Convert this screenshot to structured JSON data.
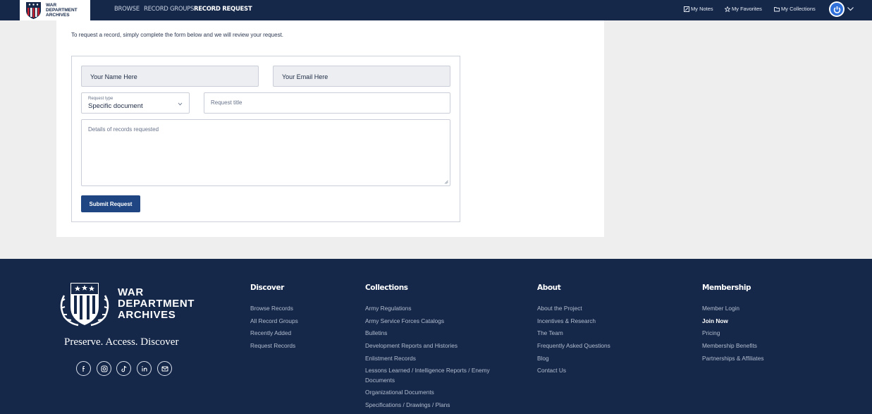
{
  "brand": {
    "logo_lines": [
      "WAR",
      "DEPARTMENT",
      "ARCHIVES"
    ],
    "footer_brand_lines": [
      "WAR",
      "DEPARTMENT",
      "ARCHIVES"
    ],
    "tagline": "Preserve. Access. Discover"
  },
  "nav": {
    "links": [
      "BROWSE",
      "RECORD GROUPS",
      "RECORD REQUEST"
    ],
    "active": "RECORD REQUEST",
    "utility": [
      "My Notes",
      "My Favorites",
      "My Collections"
    ]
  },
  "form": {
    "intro": "To request a record, simply complete the form below and we will review your request.",
    "name_value": "Your Name Here",
    "email_value": "Your Email Here",
    "request_type_label": "Request type",
    "request_type_value": "Specific document",
    "title_placeholder": "Request title",
    "details_placeholder": "Details of records requested",
    "submit_label": "Submit Request"
  },
  "footer": {
    "social_icons": [
      "facebook-icon",
      "instagram-icon",
      "tiktok-icon",
      "linkedin-icon",
      "mail-icon"
    ],
    "columns": [
      {
        "title": "Discover",
        "links": [
          "Browse Records",
          "All Record Groups",
          "Recently Added",
          "Request Records"
        ]
      },
      {
        "title": "Collections",
        "links": [
          "Army Regulations",
          "Army Service Forces Catalogs",
          "Bulletins",
          "Development Reports and Histories",
          "Enlistment Records",
          "Lessons Learned / Intelligence Reports / Enemy",
          "Documents",
          "Organizational Documents",
          "Specifications / Drawings / Plans"
        ]
      },
      {
        "title": "About",
        "links": [
          "About the Project",
          "Incentives & Research",
          "The Team",
          "Frequently Asked Questions",
          "Blog",
          "Contact Us"
        ]
      },
      {
        "title": "Membership",
        "links": [
          "Member Login",
          "Join Now",
          "Pricing",
          "Membership Benefits",
          "Partnerships & Affiliates"
        ]
      }
    ]
  },
  "colors": {
    "navy": "#15284a",
    "button": "#1f4682",
    "avatar": "#2e6fd9"
  }
}
